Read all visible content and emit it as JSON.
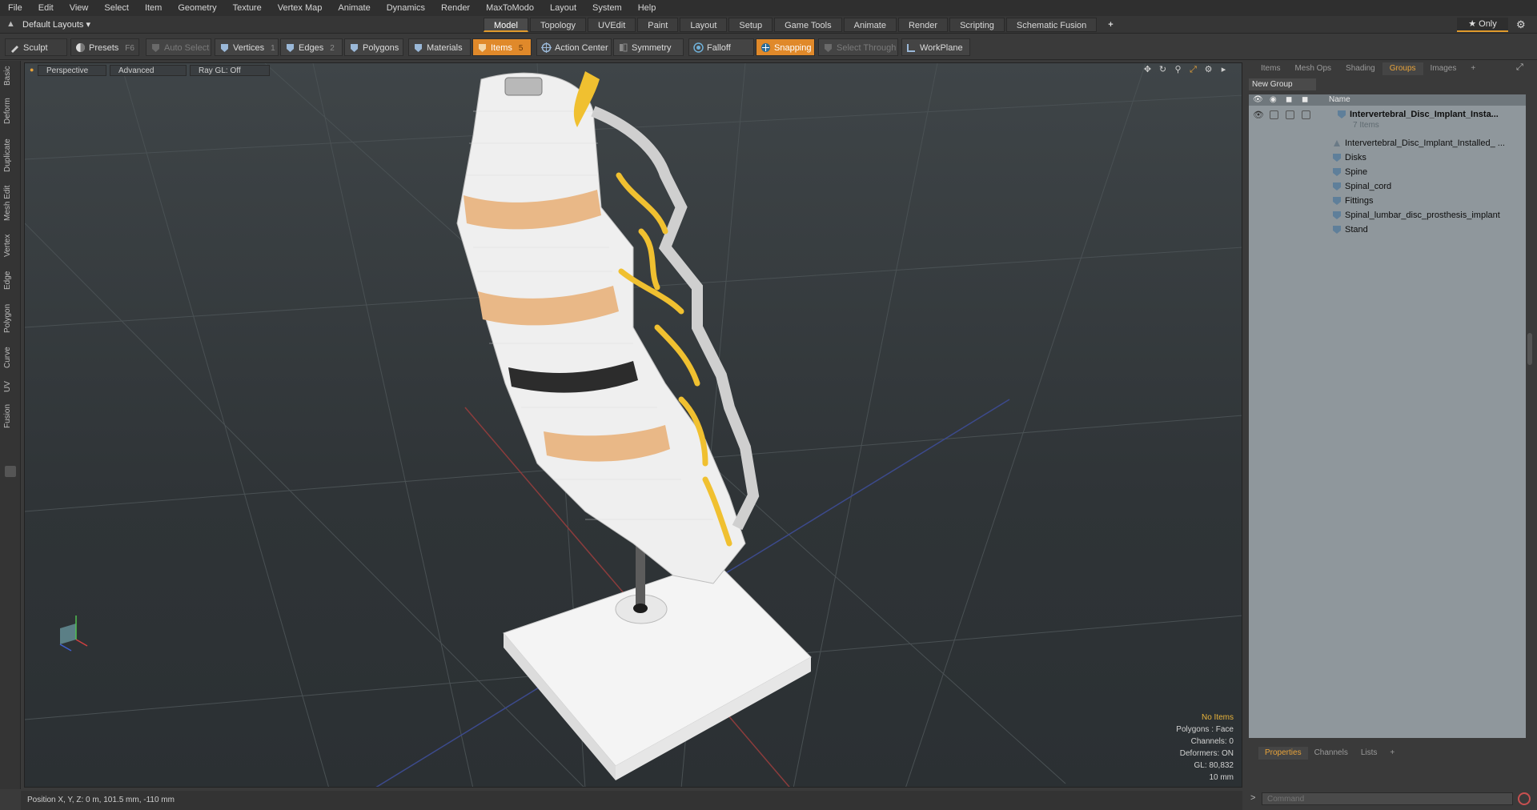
{
  "menu": [
    "File",
    "Edit",
    "View",
    "Select",
    "Item",
    "Geometry",
    "Texture",
    "Vertex Map",
    "Animate",
    "Dynamics",
    "Render",
    "MaxToModo",
    "Layout",
    "System",
    "Help"
  ],
  "layout_selector": "Default Layouts ▾",
  "mode_tabs": [
    "Model",
    "Topology",
    "UVEdit",
    "Paint",
    "Layout",
    "Setup",
    "Game Tools",
    "Animate",
    "Render",
    "Scripting",
    "Schematic Fusion",
    "+"
  ],
  "active_mode_tab": "Model",
  "only_button": "★ Only",
  "toolbar": {
    "sculpt": "Sculpt",
    "presets": "Presets",
    "presets_key": "F6",
    "auto_select": "Auto Select",
    "vertices": "Vertices",
    "vertices_key": "1",
    "edges": "Edges",
    "edges_key": "2",
    "polygons": "Polygons",
    "materials": "Materials",
    "items": "Items",
    "items_key": "5",
    "action_center": "Action Center",
    "symmetry": "Symmetry",
    "falloff": "Falloff",
    "snapping": "Snapping",
    "select_through": "Select Through",
    "workplane": "WorkPlane"
  },
  "left_tabs": [
    "Basic",
    "Deform",
    "Duplicate",
    "Mesh Edit",
    "Vertex",
    "Edge",
    "Polygon",
    "Curve",
    "UV",
    "Fusion"
  ],
  "viewport": {
    "view_mode": "Perspective",
    "shading": "Advanced",
    "raygl": "Ray GL: Off",
    "stats": {
      "selection": "No Items",
      "polygons": "Polygons : Face",
      "channels": "Channels: 0",
      "deformers": "Deformers: ON",
      "gl": "GL: 80,832",
      "scale": "10 mm"
    }
  },
  "status": "Position X, Y, Z:  0 m, 101.5 mm, -110 mm",
  "right_panel": {
    "tabs": [
      "Items",
      "Mesh Ops",
      "Shading",
      "Groups",
      "Images",
      "+"
    ],
    "active_tab": "Groups",
    "new_group": "New Group",
    "column_name": "Name",
    "group": {
      "name": "Intervertebral_Disc_Implant_Insta...",
      "count": "7 Items"
    },
    "items": [
      "Intervertebral_Disc_Implant_Installed_ ...",
      "Disks",
      "Spine",
      "Spinal_cord",
      "Fittings",
      "Spinal_lumbar_disc_prosthesis_implant",
      "Stand"
    ],
    "bottom_tabs": [
      "Properties",
      "Channels",
      "Lists",
      "+"
    ],
    "active_bottom_tab": "Properties",
    "command_placeholder": "Command"
  },
  "colors": {
    "accent": "#e09a2c",
    "bone": "#ededed",
    "disc": "#e9b887",
    "nerve": "#f0c030",
    "viewport_bg": "#32383b"
  }
}
